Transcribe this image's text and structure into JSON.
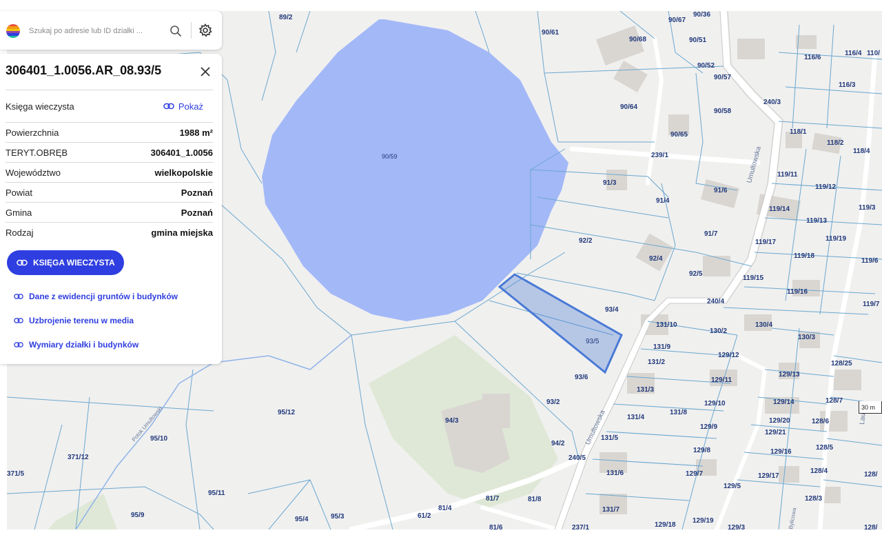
{
  "search": {
    "placeholder": "Szukaj po adresie lub ID działki ...",
    "icons": {
      "logo": "app-logo",
      "search": "search-icon",
      "settings": "gear-icon"
    }
  },
  "panel": {
    "title": "306401_1.0056.AR_08.93/5",
    "close_icon": "close-icon",
    "rows": [
      {
        "label": "Księga wieczysta",
        "value": "Pokaż",
        "is_link": true
      },
      {
        "label": "Powierzchnia",
        "value": "1988 m²"
      },
      {
        "label": "TERYT.OBRĘB",
        "value": "306401_1.0056"
      },
      {
        "label": "Województwo",
        "value": "wielkopolskie"
      },
      {
        "label": "Powiat",
        "value": "Poznań"
      },
      {
        "label": "Gmina",
        "value": "Poznań"
      },
      {
        "label": "Rodzaj",
        "value": "gmina miejska"
      }
    ],
    "primary_button": "KSIĘGA WIECZYSTA",
    "links": [
      "Dane z ewidencji gruntów i budynków",
      "Uzbrojenie terenu w media",
      "Wymiary działki i budynków"
    ],
    "accent_color": "#2f3ee0"
  },
  "map": {
    "water_color": "#a3b8f7",
    "green_color": "#dfe8d6",
    "selected_plot": "93/5",
    "selected_color": "#4a7ad6",
    "plot_labels": {
      "p89_2": "89/2",
      "p90_36": "90/36",
      "p90_67": "90/67",
      "p90_61": "90/61",
      "p90_68": "90/68",
      "p90_51": "90/51",
      "p90_52": "90/52",
      "p90_57": "90/57",
      "p90_64": "90/64",
      "p90_58": "90/58",
      "p90_65": "90/65",
      "p90_59": "90/59",
      "p240_3": "240/3",
      "p116_6": "116/6",
      "p116_4": "116/4",
      "p110": "110/",
      "p116_3": "116/3",
      "p118_1": "118/1",
      "p118_2": "118/2",
      "p118_4": "118/4",
      "p239_1": "239/1",
      "p91_3": "91/3",
      "p91_4": "91/4",
      "p91_6": "91/6",
      "p119_11": "119/11",
      "p119_12": "119/12",
      "p119_3": "119/3",
      "p119_14": "119/14",
      "p119_13": "119/13",
      "p91_7": "91/7",
      "p119_17": "119/17",
      "p119_19": "119/19",
      "p92_2": "92/2",
      "p92_4": "92/4",
      "p119_18": "119/18",
      "p119_6": "119/6",
      "p92_5": "92/5",
      "p119_15": "119/15",
      "p119_16": "119/16",
      "p240_4": "240/4",
      "p93_4": "93/4",
      "p119_7": "119/7",
      "p131_10": "131/10",
      "p130_4": "130/4",
      "p130_2": "130/2",
      "p130_3": "130/3",
      "p93_5": "93/5",
      "p131_9": "131/9",
      "p129_12": "129/12",
      "p131_2": "131/2",
      "p128_25": "128/25",
      "p93_6": "93/6",
      "p129_13": "129/13",
      "p129_11": "129/11",
      "p131_3": "131/3",
      "p129_14": "129/14",
      "p128_7": "128/7",
      "p93_2": "93/2",
      "p129_10": "129/10",
      "p95_12": "95/12",
      "p131_4": "131/4",
      "p131_8": "131/8",
      "p129_20": "129/20",
      "p128_6": "128/6",
      "p94_3": "94/3",
      "p129_9": "129/9",
      "p129_21": "129/21",
      "p95_10": "95/10",
      "p131_5": "131/5",
      "p94_2": "94/2",
      "p129_8": "129/8",
      "p129_16": "129/16",
      "p128_5": "128/5",
      "p371_12": "371/12",
      "p240_5": "240/5",
      "p131_6": "131/6",
      "p129_7": "129/7",
      "p128_4": "128/4",
      "p129_17": "129/17",
      "p128_": "128/",
      "p371_5": "371/5",
      "p95_11": "95/11",
      "p129_5": "129/5",
      "p128_3": "128/3",
      "p81_7": "81/7",
      "p81_8": "81/8",
      "p131_7": "131/7",
      "p95_9": "95/9",
      "p95_4": "95/4",
      "p95_3": "95/3",
      "p81_4": "81/4",
      "p61_2": "61/2",
      "p81_6": "81/6",
      "p237_1": "237/1",
      "p129_18": "129/18",
      "p129_19": "129/19",
      "p129_3": "129/3",
      "p128_b": "128/"
    },
    "street_labels": {
      "umultowska_n": "Umultowska",
      "umultowska_s": "Umultowska",
      "potok": "Potok Umultowski",
      "bylicowa": "Bylicowa",
      "laur": "Lau"
    },
    "scale_label": "30 m"
  }
}
